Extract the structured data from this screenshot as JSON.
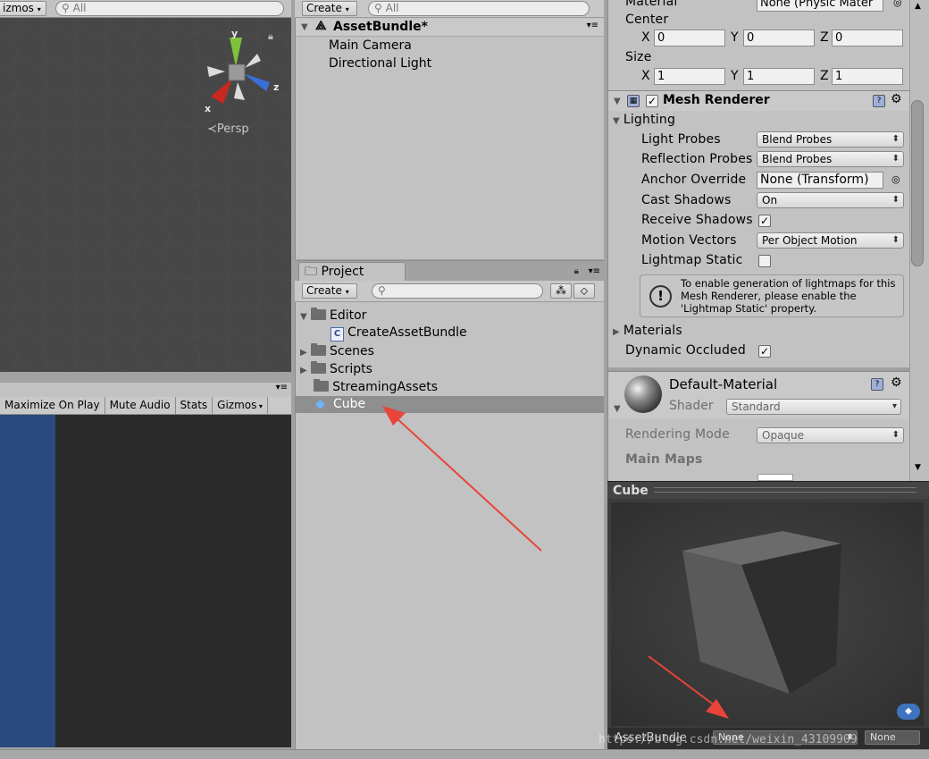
{
  "scene": {
    "gizmos_label": "izmos",
    "search_placeholder": "All",
    "persp_label": "Persp",
    "gizmo_axes": {
      "y": "y",
      "z": "z",
      "x": "x"
    }
  },
  "game": {
    "toolbar": [
      "Maximize On Play",
      "Mute Audio",
      "Stats",
      "Gizmos"
    ]
  },
  "hierarchy": {
    "create_label": "Create",
    "search_placeholder": "All",
    "scene_name": "AssetBundle*",
    "items": [
      "Main Camera",
      "Directional Light"
    ]
  },
  "project": {
    "tab_label": "Project",
    "create_label": "Create",
    "tree": {
      "editor": "Editor",
      "create_asset_bundle": "CreateAssetBundle",
      "scenes": "Scenes",
      "scripts": "Scripts",
      "streaming_assets": "StreamingAssets",
      "cube": "Cube"
    }
  },
  "inspector": {
    "collider": {
      "material_label": "Material",
      "material_value": "None (Physic Mater",
      "center_label": "Center",
      "center": {
        "x": "0",
        "y": "0",
        "z": "0"
      },
      "size_label": "Size",
      "size": {
        "x": "1",
        "y": "1",
        "z": "1"
      },
      "axis": {
        "x": "X",
        "y": "Y",
        "z": "Z"
      }
    },
    "mesh_renderer": {
      "title": "Mesh Renderer",
      "lighting_label": "Lighting",
      "light_probes_label": "Light Probes",
      "light_probes_value": "Blend Probes",
      "reflection_probes_label": "Reflection Probes",
      "reflection_probes_value": "Blend Probes",
      "anchor_override_label": "Anchor Override",
      "anchor_override_value": "None (Transform)",
      "cast_shadows_label": "Cast Shadows",
      "cast_shadows_value": "On",
      "receive_shadows_label": "Receive Shadows",
      "motion_vectors_label": "Motion Vectors",
      "motion_vectors_value": "Per Object Motion",
      "lightmap_static_label": "Lightmap Static",
      "info_text": "To enable generation of lightmaps for this Mesh Renderer, please enable the 'Lightmap Static' property.",
      "materials_label": "Materials",
      "dynamic_occluded_label": "Dynamic Occluded"
    },
    "material": {
      "name": "Default-Material",
      "shader_label": "Shader",
      "shader_value": "Standard",
      "rendering_mode_label": "Rendering Mode",
      "rendering_mode_value": "Opaque",
      "main_maps_label": "Main Maps"
    }
  },
  "preview": {
    "title": "Cube",
    "asset_bundle_label": "AssetBundle",
    "asset_bundle_value": "None",
    "variant_value": "None"
  },
  "watermark": "https://blog.csdn.net/weixin_43109909",
  "colors": {
    "panel_bg": "#c2c2c2",
    "scene_bg": "#484848",
    "selection": "#8f8f8f",
    "arrow_red": "#e8443a",
    "game_blue": "#2a4a7e"
  }
}
